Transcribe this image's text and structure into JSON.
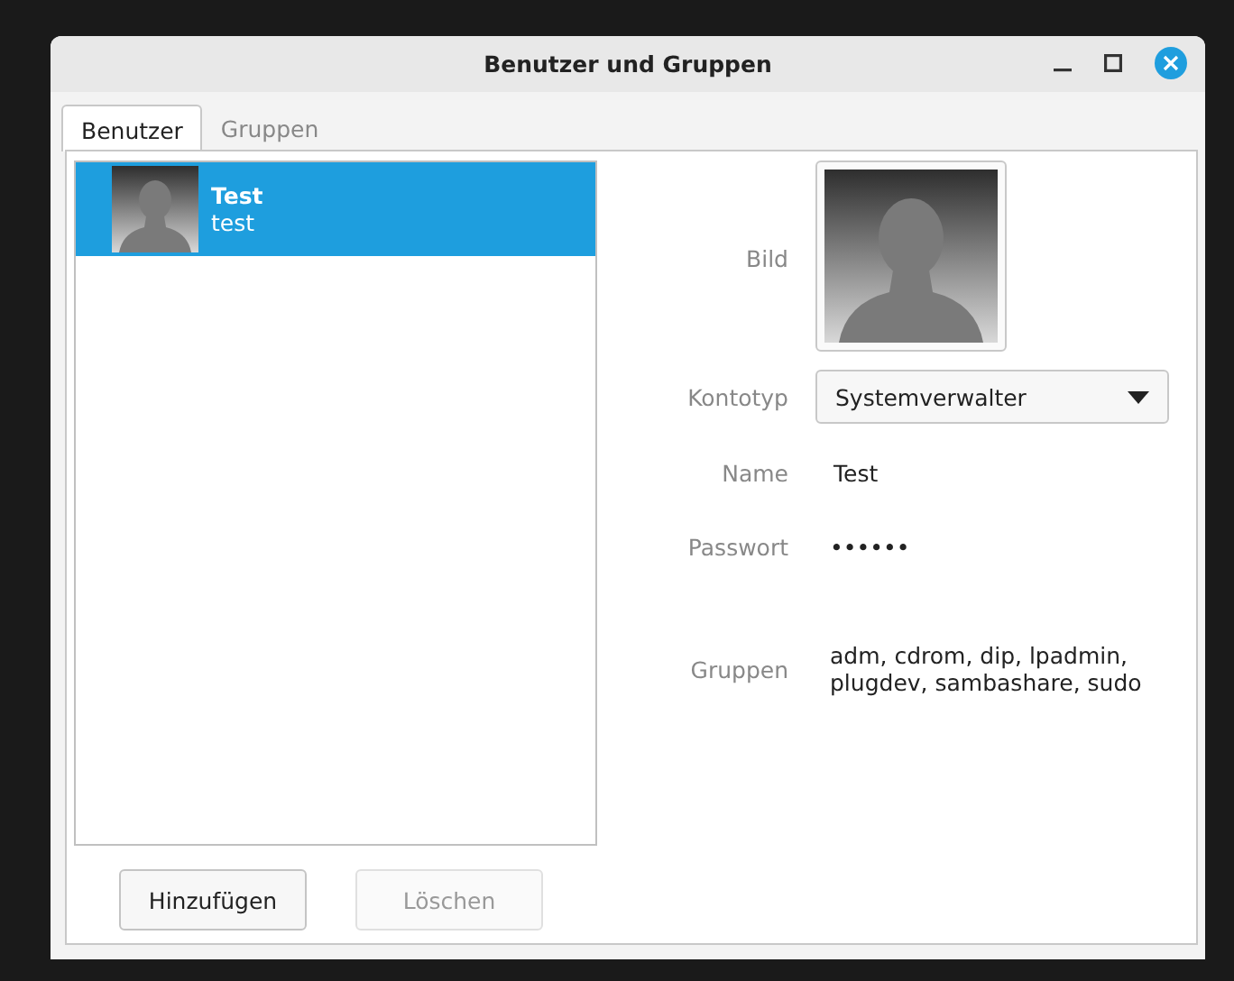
{
  "window": {
    "title": "Benutzer und Gruppen"
  },
  "tabs": [
    {
      "label": "Benutzer",
      "selected": true
    },
    {
      "label": "Gruppen",
      "selected": false
    }
  ],
  "users": [
    {
      "name": "Test",
      "login": "test",
      "selected": true
    }
  ],
  "details": {
    "picture_label": "Bild",
    "account_type": {
      "label": "Kontotyp",
      "value": "Systemverwalter"
    },
    "name": {
      "label": "Name",
      "value": "Test"
    },
    "password": {
      "label": "Passwort",
      "value": "••••••"
    },
    "groups": {
      "label": "Gruppen",
      "value": "adm, cdrom, dip, lpadmin, plugdev, sambashare, sudo"
    }
  },
  "buttons": [
    {
      "label": "Hinzufügen",
      "disabled": false
    },
    {
      "label": "Löschen",
      "disabled": true
    }
  ]
}
